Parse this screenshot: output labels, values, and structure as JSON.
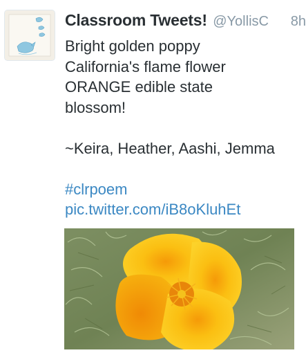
{
  "tweet": {
    "author": {
      "display_name": "Classroom Tweets!",
      "handle": "@YollisC",
      "avatar_icon": "classroom-bird-drawing-icon"
    },
    "timestamp": "8h",
    "lines": [
      "Bright golden poppy",
      "California's flame flower",
      "ORANGE edible state",
      "blossom!"
    ],
    "signature": "~Keira, Heather, Aashi, Jemma",
    "hashtag": "#clrpoem",
    "media_link": "pic.twitter.com/iB8oKluhEt"
  },
  "colors": {
    "text": "#292f33",
    "meta": "#8899a6",
    "link": "#3b88c3"
  }
}
